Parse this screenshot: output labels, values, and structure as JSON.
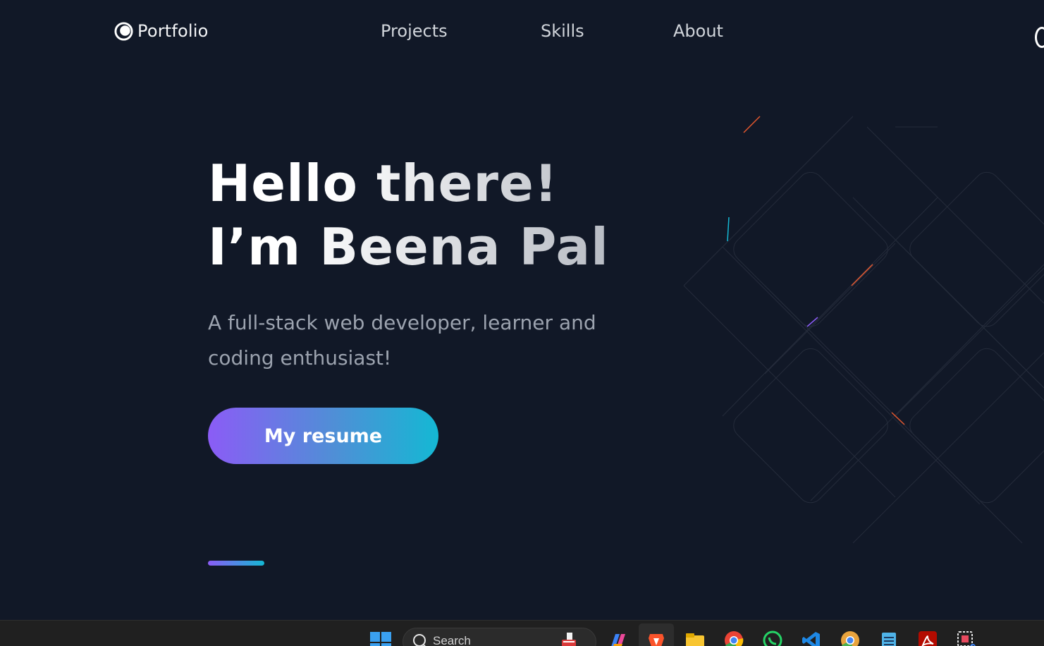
{
  "nav": {
    "logo_text": "Portfolio",
    "links": [
      "Projects",
      "Skills",
      "About"
    ]
  },
  "hero": {
    "title_line1": "Hello there!",
    "title_line2": "I’m Beena Pal",
    "subtitle": "A full-stack web developer, learner and coding enthusiast!",
    "cta_label": "My resume"
  },
  "taskbar": {
    "search_placeholder": "Search",
    "icons": [
      "windows-start-icon",
      "copilot-icon",
      "brave-browser-icon",
      "file-explorer-icon",
      "chrome-icon",
      "whatsapp-icon",
      "vscode-icon",
      "chrome-canary-icon",
      "notepad-icon",
      "acrobat-icon",
      "snipping-tool-icon"
    ]
  },
  "colors": {
    "background": "#111827",
    "accent_start": "#8b5cf6",
    "accent_end": "#14b8d4"
  }
}
